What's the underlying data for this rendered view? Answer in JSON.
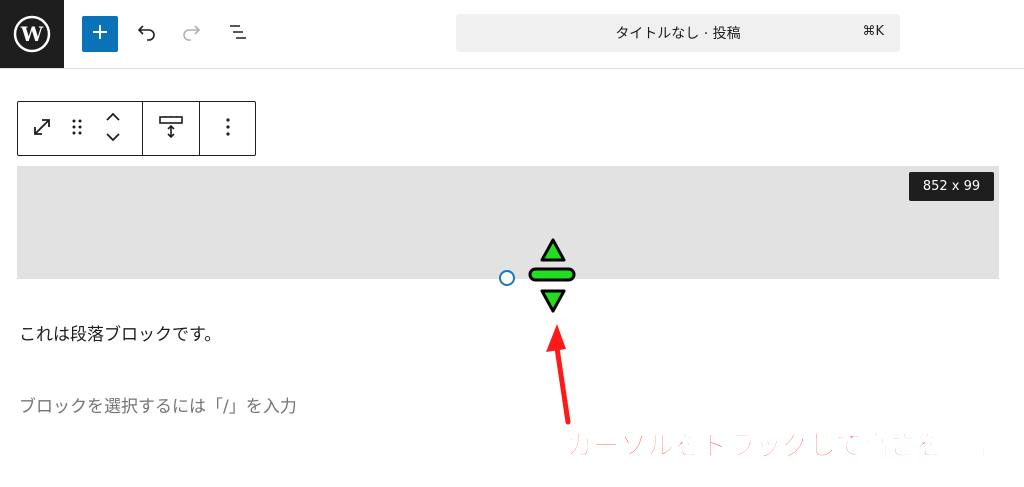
{
  "topbar": {
    "command_title": "タイトルなし · 投稿",
    "command_shortcut": "⌘K"
  },
  "icons": {
    "wp_logo": "wordpress-logo-icon",
    "add": "plus-icon",
    "undo": "undo-icon",
    "redo": "redo-icon",
    "list_view": "list-view-icon",
    "transform": "resize-arrows-icon",
    "drag": "drag-handle-icon",
    "move": "move-up-down-icon",
    "spacer": "spacer-icon",
    "more": "more-vertical-icon"
  },
  "spacer": {
    "size_label": "852 x 99"
  },
  "content": {
    "paragraph_text": "これは段落ブロックです。",
    "placeholder_text": "ブロックを選択するには「/」を入力"
  },
  "annotation": {
    "text": "カーソルをドラッグして高さを調整"
  },
  "colors": {
    "accent": "#0a73b8",
    "annotation": "#ff1a1a",
    "cursor_fill": "#22dd22"
  }
}
